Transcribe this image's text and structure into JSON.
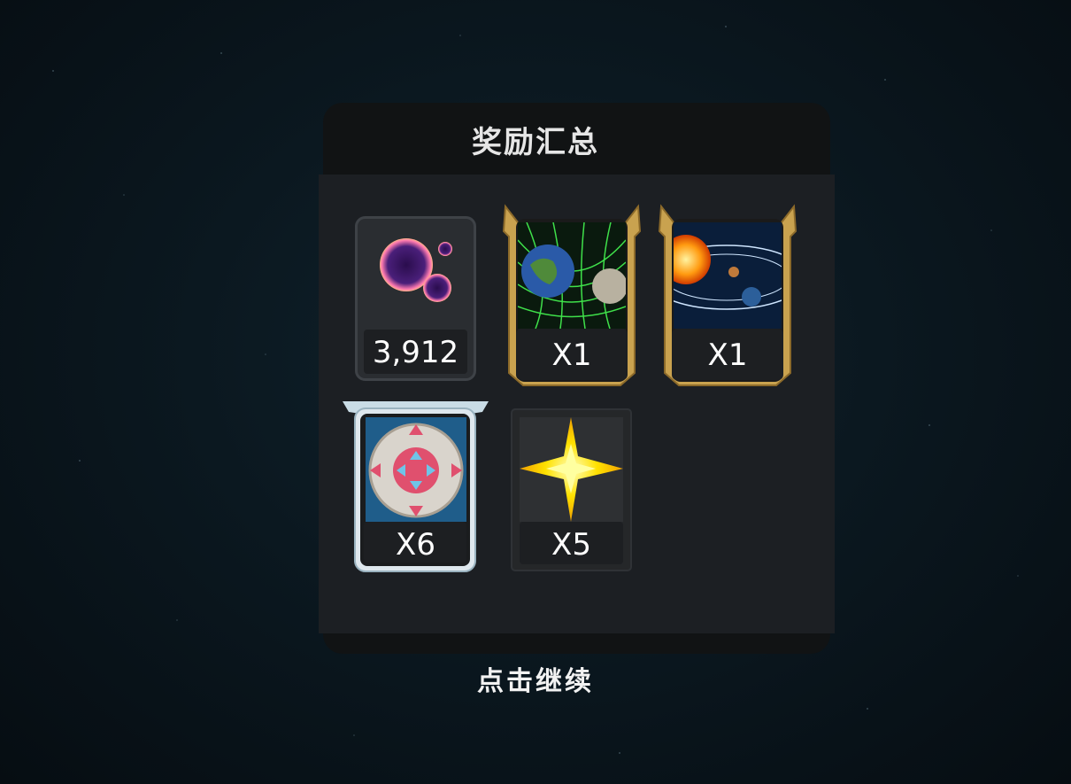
{
  "title": "奖励汇总",
  "continue_label": "点击继续",
  "rewards": [
    {
      "icon": "dark-matter-orbs-icon",
      "quantity": "3,912",
      "frame": "dark"
    },
    {
      "icon": "earth-moon-gravity-grid-icon",
      "quantity": "X1",
      "frame": "gold"
    },
    {
      "icon": "solar-system-orbit-icon",
      "quantity": "X1",
      "frame": "gold"
    },
    {
      "icon": "expansion-arrows-icon",
      "quantity": "X6",
      "frame": "silver"
    },
    {
      "icon": "star-burst-icon",
      "quantity": "X5",
      "frame": "plain"
    }
  ],
  "colors": {
    "gold": "#c9a24f",
    "silver": "#c9dce6",
    "panel": "#1c1f23"
  }
}
